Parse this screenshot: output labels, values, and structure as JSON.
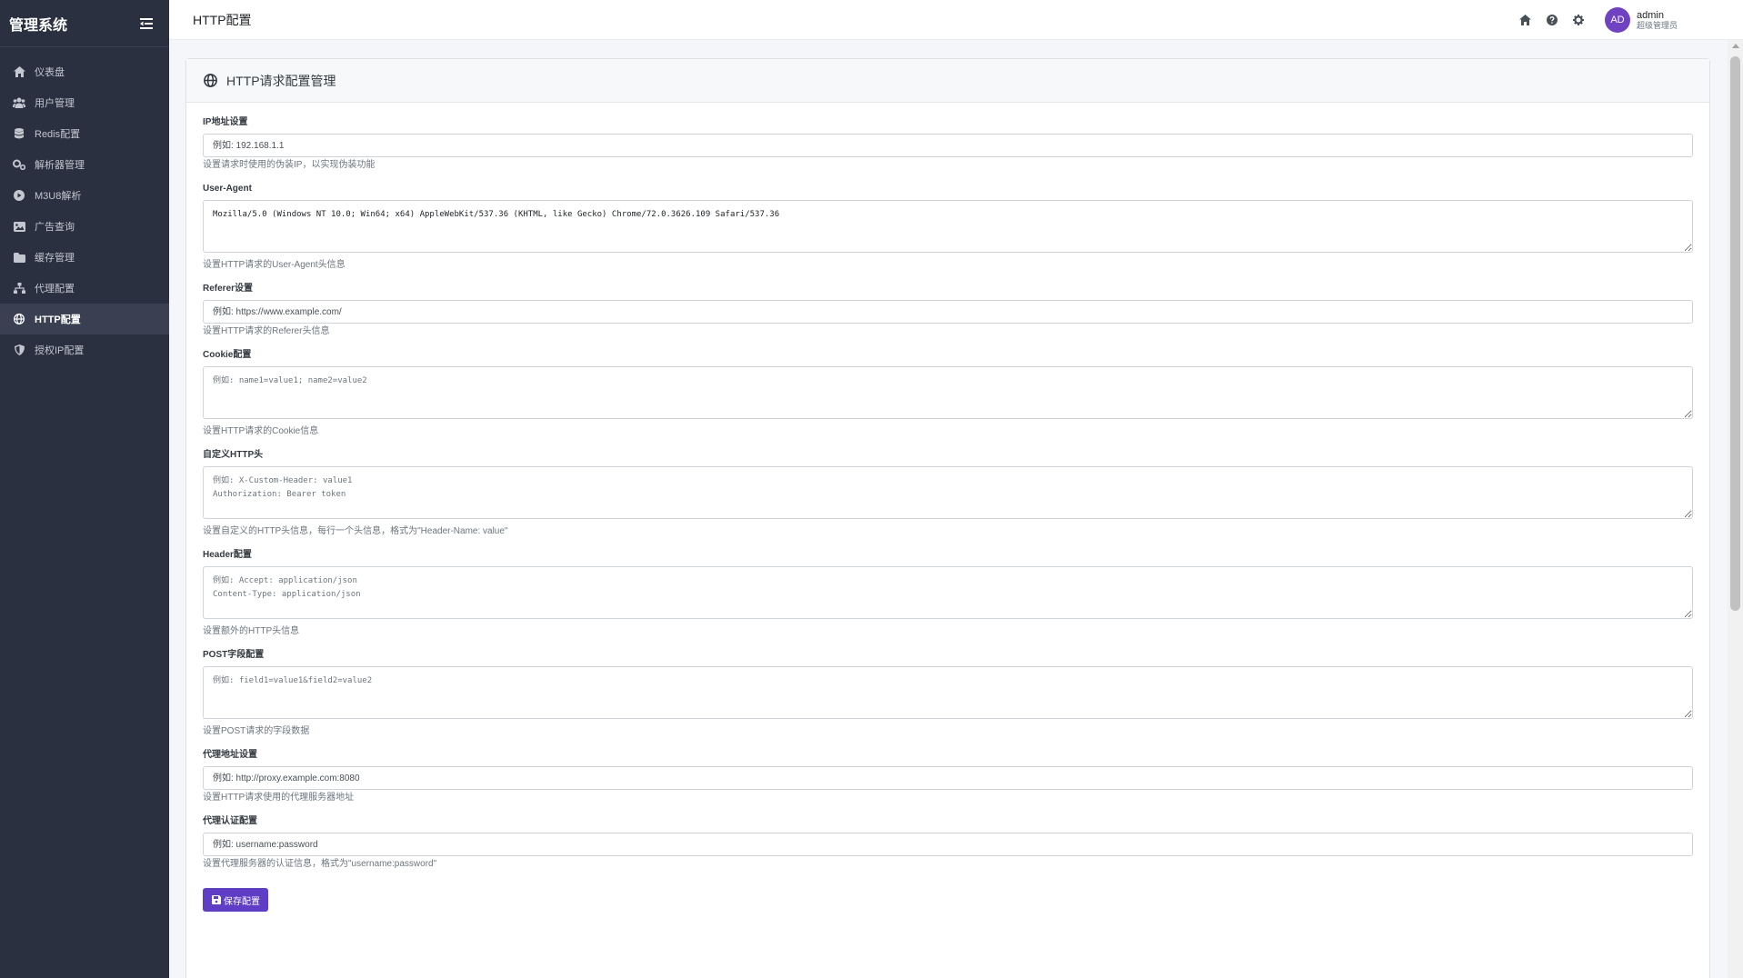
{
  "sidebar": {
    "brand": "管理系统",
    "items": [
      {
        "label": "仪表盘",
        "icon": "home-icon"
      },
      {
        "label": "用户管理",
        "icon": "users-icon"
      },
      {
        "label": "Redis配置",
        "icon": "database-icon"
      },
      {
        "label": "解析器管理",
        "icon": "cogs-icon"
      },
      {
        "label": "M3U8解析",
        "icon": "play-circle-icon"
      },
      {
        "label": "广告查询",
        "icon": "image-icon"
      },
      {
        "label": "缓存管理",
        "icon": "folder-icon"
      },
      {
        "label": "代理配置",
        "icon": "sitemap-icon"
      },
      {
        "label": "HTTP配置",
        "icon": "globe-icon",
        "active": true
      },
      {
        "label": "授权IP配置",
        "icon": "shield-icon"
      }
    ]
  },
  "header": {
    "title": "HTTP配置",
    "user": {
      "initials": "AD",
      "name": "admin",
      "role": "超级管理员"
    }
  },
  "card": {
    "title": "HTTP请求配置管理",
    "fields": {
      "ip": {
        "label": "IP地址设置",
        "placeholder": "例如: 192.168.1.1",
        "help": "设置请求时使用的伪装IP，以实现伪装功能"
      },
      "ua": {
        "label": "User-Agent",
        "value": "Mozilla/5.0 (Windows NT 10.0; Win64; x64) AppleWebKit/537.36 (KHTML, like Gecko) Chrome/72.0.3626.109 Safari/537.36",
        "help": "设置HTTP请求的User-Agent头信息"
      },
      "referer": {
        "label": "Referer设置",
        "placeholder": "例如: https://www.example.com/",
        "help": "设置HTTP请求的Referer头信息"
      },
      "cookie": {
        "label": "Cookie配置",
        "placeholder": "例如: name1=value1; name2=value2",
        "help": "设置HTTP请求的Cookie信息"
      },
      "custom_headers": {
        "label": "自定义HTTP头",
        "placeholder": "例如: X-Custom-Header: value1\nAuthorization: Bearer token",
        "help": "设置自定义的HTTP头信息，每行一个头信息，格式为\"Header-Name: value\""
      },
      "header": {
        "label": "Header配置",
        "placeholder": "例如: Accept: application/json\nContent-Type: application/json",
        "help": "设置额外的HTTP头信息"
      },
      "post": {
        "label": "POST字段配置",
        "placeholder": "例如: field1=value1&field2=value2",
        "help": "设置POST请求的字段数据"
      },
      "proxy": {
        "label": "代理地址设置",
        "placeholder": "例如: http://proxy.example.com:8080",
        "help": "设置HTTP请求使用的代理服务器地址"
      },
      "proxy_auth": {
        "label": "代理认证配置",
        "placeholder": "例如: username:password",
        "help": "设置代理服务器的认证信息，格式为\"username:password\""
      }
    },
    "save_label": "保存配置"
  },
  "colors": {
    "sidebar_bg": "#2b3040",
    "accent": "#5f3dc4",
    "avatar_bg": "#6f42c1"
  }
}
